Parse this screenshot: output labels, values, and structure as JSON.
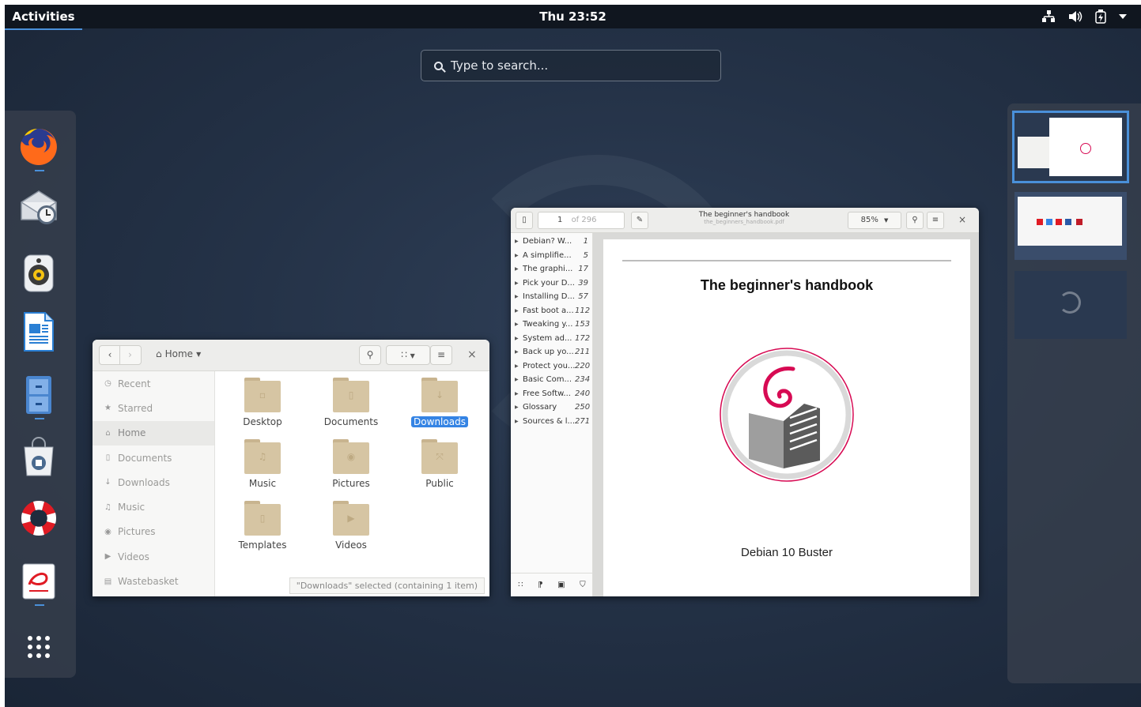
{
  "topbar": {
    "activities": "Activities",
    "clock": "Thu 23:52",
    "tray_icons": [
      "network-icon",
      "volume-icon",
      "battery-icon",
      "system-menu-arrow-icon"
    ]
  },
  "search": {
    "placeholder": "Type to search..."
  },
  "dash": {
    "apps": [
      "firefox",
      "evolution",
      "rhythmbox",
      "libreoffice-writer",
      "files",
      "software",
      "help",
      "evince"
    ],
    "running": [
      "firefox",
      "files",
      "evince"
    ],
    "show_apps": "show-applications-icon"
  },
  "files": {
    "location": "Home",
    "sidebar": [
      {
        "label": "Recent",
        "icon": "clock-icon"
      },
      {
        "label": "Starred",
        "icon": "star-icon"
      },
      {
        "label": "Home",
        "icon": "home-icon",
        "active": true
      },
      {
        "label": "Documents",
        "icon": "document-icon"
      },
      {
        "label": "Downloads",
        "icon": "download-icon"
      },
      {
        "label": "Music",
        "icon": "music-icon"
      },
      {
        "label": "Pictures",
        "icon": "camera-icon"
      },
      {
        "label": "Videos",
        "icon": "video-icon"
      },
      {
        "label": "Wastebasket",
        "icon": "trash-icon"
      }
    ],
    "folders": [
      {
        "label": "Desktop",
        "emblem": "▫"
      },
      {
        "label": "Documents",
        "emblem": "▯"
      },
      {
        "label": "Downloads",
        "emblem": "↓",
        "selected": true
      },
      {
        "label": "Music",
        "emblem": "♫"
      },
      {
        "label": "Pictures",
        "emblem": "◉"
      },
      {
        "label": "Public",
        "emblem": "⤧"
      },
      {
        "label": "Templates",
        "emblem": "▯"
      },
      {
        "label": "Videos",
        "emblem": "▶"
      }
    ],
    "status": "\"Downloads\" selected (containing 1 item)"
  },
  "docviewer": {
    "page_current": "1",
    "page_total": "of 296",
    "title": "The beginner's handbook",
    "filename": "the_beginners_handbook.pdf",
    "zoom": "85%",
    "toc": [
      {
        "title": "Debian? W...",
        "page": "1"
      },
      {
        "title": "A simplifie...",
        "page": "5"
      },
      {
        "title": "The graphi...",
        "page": "17"
      },
      {
        "title": "Pick your D...",
        "page": "39"
      },
      {
        "title": "Installing D...",
        "page": "57"
      },
      {
        "title": "Fast boot a...",
        "page": "112"
      },
      {
        "title": "Tweaking y...",
        "page": "153"
      },
      {
        "title": "System ad...",
        "page": "172"
      },
      {
        "title": "Back up yo...",
        "page": "211"
      },
      {
        "title": "Protect you...",
        "page": "220"
      },
      {
        "title": "Basic Com...",
        "page": "234"
      },
      {
        "title": "Free Softw...",
        "page": "240"
      },
      {
        "title": "Glossary",
        "page": "250"
      },
      {
        "title": "Sources & l...",
        "page": "271"
      }
    ],
    "page_title": "The beginner's handbook",
    "page_subtitle": "Debian 10 Buster",
    "logo_color": "#d70a53"
  },
  "workspaces": {
    "count": 3,
    "current": 0
  },
  "colors": {
    "accent": "#3584e4",
    "topbar": "#10161f",
    "folder": "#d6c5a3"
  }
}
